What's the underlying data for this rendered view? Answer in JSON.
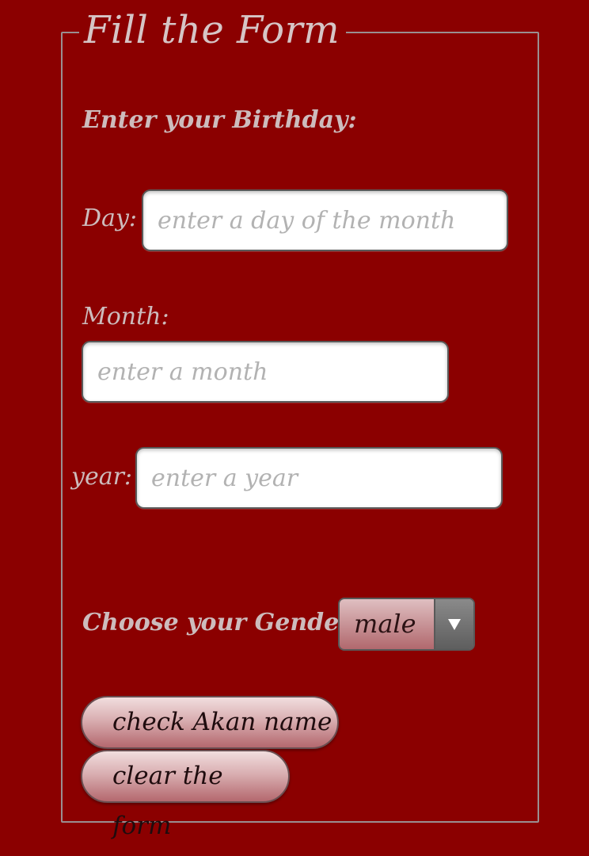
{
  "form": {
    "legend": "Fill the Form",
    "birthday_heading": "Enter your Birthday:",
    "day": {
      "label": "Day:",
      "value": "",
      "placeholder": "enter a day of the month"
    },
    "month": {
      "label": "Month:",
      "value": "",
      "placeholder": "enter a month"
    },
    "year": {
      "label": "year:",
      "value": "",
      "placeholder": "enter a year"
    },
    "gender": {
      "label": "Choose your Gender:",
      "selected": "male",
      "arrow_icon": "triangle-down-icon"
    },
    "buttons": {
      "check_label": "check Akan name",
      "clear_label": "clear the form"
    }
  },
  "colors": {
    "background": "#8b0000",
    "label_text": "#cdbcbd",
    "button_gradient_top": "#f1dede",
    "button_gradient_bottom": "#b4686e",
    "border": "#9a8f91"
  }
}
